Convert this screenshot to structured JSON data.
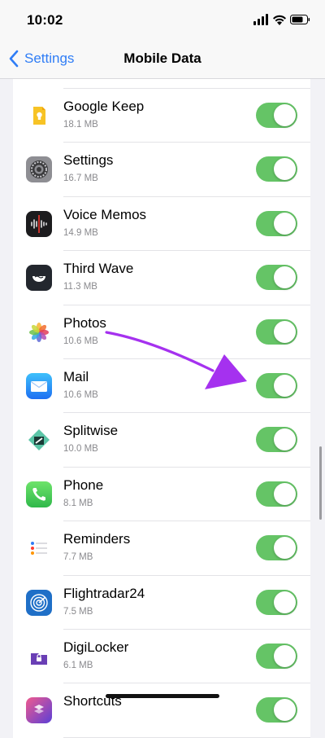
{
  "status": {
    "time": "10:02"
  },
  "nav": {
    "back_label": "Settings",
    "title": "Mobile Data"
  },
  "apps": [
    {
      "name": "Google Keep",
      "size": "18.1 MB",
      "icon": "google-keep-icon",
      "enabled": true
    },
    {
      "name": "Settings",
      "size": "16.7 MB",
      "icon": "settings-gear-icon",
      "enabled": true
    },
    {
      "name": "Voice Memos",
      "size": "14.9 MB",
      "icon": "voice-memos-icon",
      "enabled": true
    },
    {
      "name": "Third Wave",
      "size": "11.3 MB",
      "icon": "third-wave-icon",
      "enabled": true
    },
    {
      "name": "Photos",
      "size": "10.6 MB",
      "icon": "photos-icon",
      "enabled": true
    },
    {
      "name": "Mail",
      "size": "10.6 MB",
      "icon": "mail-icon",
      "enabled": true
    },
    {
      "name": "Splitwise",
      "size": "10.0 MB",
      "icon": "splitwise-icon",
      "enabled": true
    },
    {
      "name": "Phone",
      "size": "8.1 MB",
      "icon": "phone-icon",
      "enabled": true
    },
    {
      "name": "Reminders",
      "size": "7.7 MB",
      "icon": "reminders-icon",
      "enabled": true
    },
    {
      "name": "Flightradar24",
      "size": "7.5 MB",
      "icon": "flightradar24-icon",
      "enabled": true
    },
    {
      "name": "DigiLocker",
      "size": "6.1 MB",
      "icon": "digilocker-icon",
      "enabled": true
    },
    {
      "name": "Shortcuts",
      "size": "",
      "icon": "shortcuts-icon",
      "enabled": true
    }
  ],
  "colors": {
    "accent": "#2f7df6",
    "toggle_on": "#65c466",
    "annotation": "#a531ef"
  }
}
